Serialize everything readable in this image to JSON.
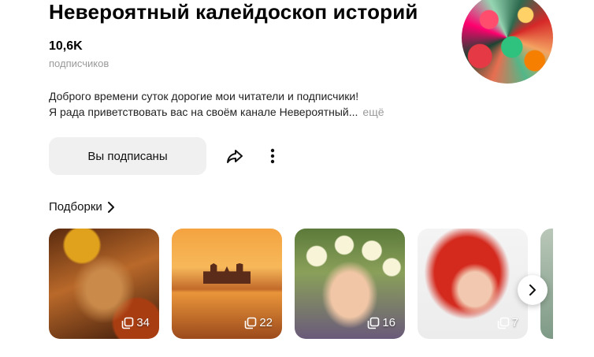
{
  "channel": {
    "title": "Невероятный калейдоскоп историй",
    "subscribers_count": "10,6K",
    "subscribers_label": "подписчиков",
    "description_line1": "Доброго времени суток дорогие мои читатели и подписчики!",
    "description_line2": "Я рада приветствовать вас на своём канале Невероятный...",
    "more_label": "ещё"
  },
  "actions": {
    "subscribed_label": "Вы подписаны",
    "share_icon": "share-icon",
    "more_icon": "more-vertical-icon"
  },
  "collections": {
    "title": "Подборки",
    "items": [
      {
        "count": "34"
      },
      {
        "count": "22"
      },
      {
        "count": "16"
      },
      {
        "count": "7"
      }
    ]
  }
}
